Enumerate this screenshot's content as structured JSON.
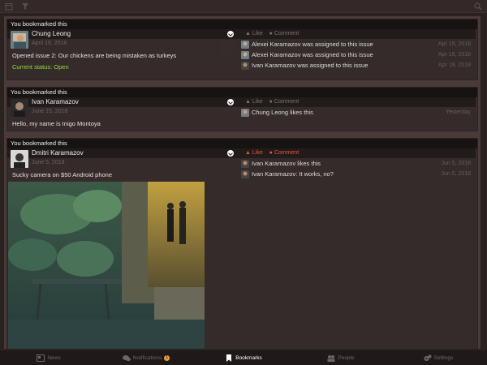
{
  "feed": {
    "cards": [
      {
        "header": "You bookmarked this",
        "author": "Chung Leong",
        "date": "April 19, 2018",
        "text": "Opened issue 2: Our chickens are being mistaken as turkeys",
        "status": "Current status: Open",
        "like_label": "Like",
        "comment_label": "Comment",
        "replies": [
          {
            "text": "Alexei Karamazov was assigned to this issue",
            "date": "Apr 19, 2018"
          },
          {
            "text": "Alexei Karamazov was assigned to this issue",
            "date": "Apr 19, 2018"
          },
          {
            "text": "Ivan Karamazov was assigned to this issue",
            "date": "Apr 19, 2018"
          }
        ]
      },
      {
        "header": "You bookmarked this",
        "author": "Ivan Karamazov",
        "date": "June 15, 2018",
        "text": "Hello, my name is Inigo Montoya",
        "like_label": "Like",
        "comment_label": "Comment",
        "replies": [
          {
            "text": "Chung Leong likes this",
            "date": "Yesterday"
          }
        ]
      },
      {
        "header": "You bookmarked this",
        "author": "Dmitri Karamazov",
        "date": "June 5, 2018",
        "text": "Sucky camera on $50 Android phone",
        "like_label": "Like",
        "comment_label": "Comment",
        "replies": [
          {
            "text": "Ivan Karamazov likes this",
            "date": "Jun 5, 2018"
          },
          {
            "text": "Ivan Karamazov: It works, no?",
            "date": "Jun 5, 2018"
          }
        ]
      }
    ]
  },
  "tabs": [
    {
      "label": "News",
      "icon": "news-icon"
    },
    {
      "label": "Notifications",
      "icon": "chat-bubbles-icon",
      "badge": "1"
    },
    {
      "label": "Bookmarks",
      "icon": "bookmark-icon",
      "active": true
    },
    {
      "label": "People",
      "icon": "people-icon"
    },
    {
      "label": "Settings",
      "icon": "gears-icon"
    }
  ],
  "colors": {
    "accent_status": "#8fdc3f",
    "liked": "#e25a3a",
    "badge": "#f0a020"
  }
}
